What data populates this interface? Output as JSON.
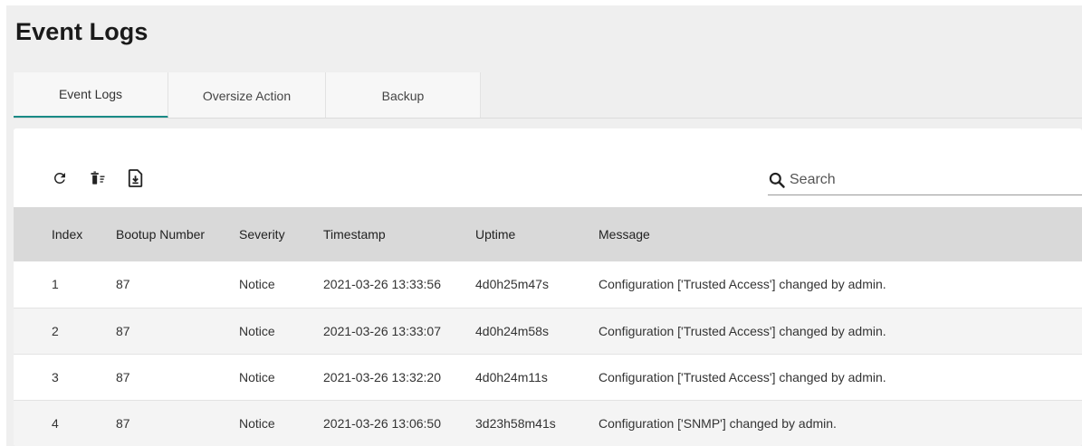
{
  "page": {
    "title": "Event Logs"
  },
  "tabs": [
    {
      "label": "Event Logs",
      "active": true
    },
    {
      "label": "Oversize Action",
      "active": false
    },
    {
      "label": "Backup",
      "active": false
    }
  ],
  "toolbar": {
    "icons": [
      "refresh-icon",
      "clear-logs-icon",
      "export-icon"
    ]
  },
  "search": {
    "placeholder": "Search",
    "value": ""
  },
  "table": {
    "columns": [
      "Index",
      "Bootup Number",
      "Severity",
      "Timestamp",
      "Uptime",
      "Message"
    ],
    "rows": [
      [
        "1",
        "87",
        "Notice",
        "2021-03-26 13:33:56",
        "4d0h25m47s",
        "Configuration ['Trusted Access'] changed by admin."
      ],
      [
        "2",
        "87",
        "Notice",
        "2021-03-26 13:33:07",
        "4d0h24m58s",
        "Configuration ['Trusted Access'] changed by admin."
      ],
      [
        "3",
        "87",
        "Notice",
        "2021-03-26 13:32:20",
        "4d0h24m11s",
        "Configuration ['Trusted Access'] changed by admin."
      ],
      [
        "4",
        "87",
        "Notice",
        "2021-03-26 13:06:50",
        "3d23h58m41s",
        "Configuration ['SNMP'] changed by admin."
      ]
    ]
  },
  "colors": {
    "accent": "#1a8a86",
    "header_bg": "#d9d9d9",
    "page_bg": "#efefef"
  }
}
